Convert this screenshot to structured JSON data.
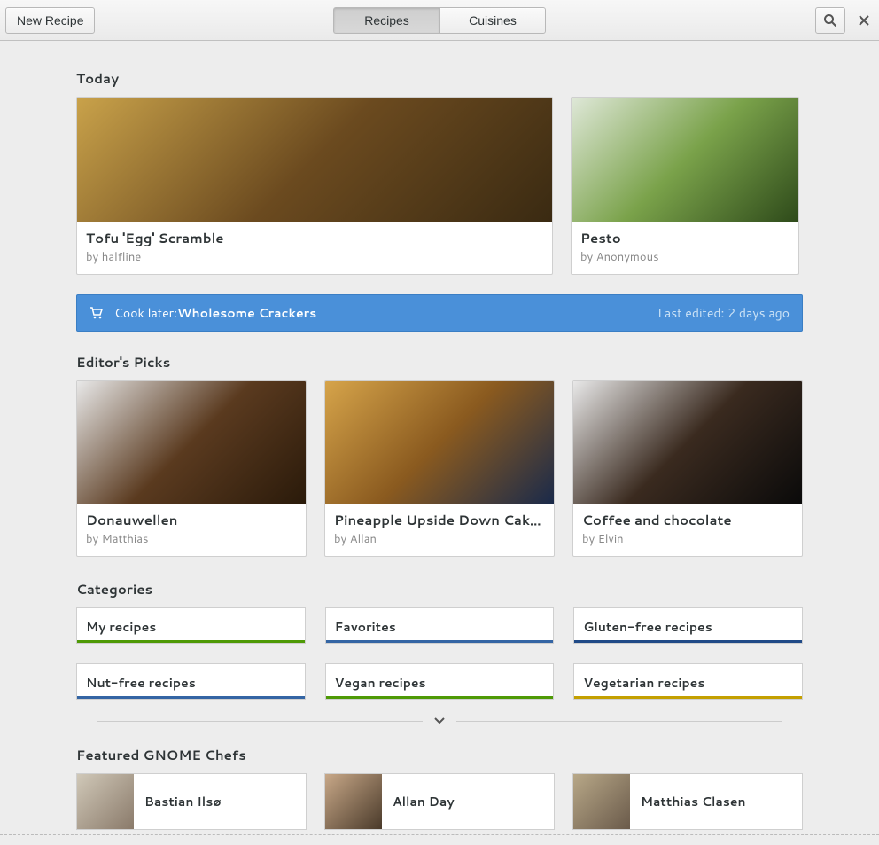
{
  "header": {
    "new_recipe": "New Recipe",
    "tabs": {
      "recipes": "Recipes",
      "cuisines": "Cuisines"
    }
  },
  "sections": {
    "today": "Today",
    "picks": "Editor's Picks",
    "categories": "Categories",
    "chefs": "Featured GNOME Chefs"
  },
  "today": [
    {
      "title": "Tofu 'Egg' Scramble",
      "by": "by halfline"
    },
    {
      "title": "Pesto",
      "by": "by Anonymous"
    }
  ],
  "banner": {
    "prefix": "Cook later: ",
    "name": "Wholesome Crackers",
    "edited": "Last edited: 2 days ago"
  },
  "picks": [
    {
      "title": "Donauwellen",
      "by": "by Matthias"
    },
    {
      "title": "Pineapple Upside Down Cake …",
      "by": "by Allan"
    },
    {
      "title": "Coffee and chocolate",
      "by": "by Elvin"
    }
  ],
  "categories": [
    {
      "label": "My recipes",
      "color": "green"
    },
    {
      "label": "Favorites",
      "color": "blue"
    },
    {
      "label": "Gluten-free recipes",
      "color": "darkblue"
    },
    {
      "label": "Nut-free recipes",
      "color": "blue"
    },
    {
      "label": "Vegan recipes",
      "color": "green"
    },
    {
      "label": "Vegetarian recipes",
      "color": "gold"
    }
  ],
  "chefs": [
    {
      "name": "Bastian Ilsø"
    },
    {
      "name": "Allan Day"
    },
    {
      "name": "Matthias Clasen"
    }
  ]
}
